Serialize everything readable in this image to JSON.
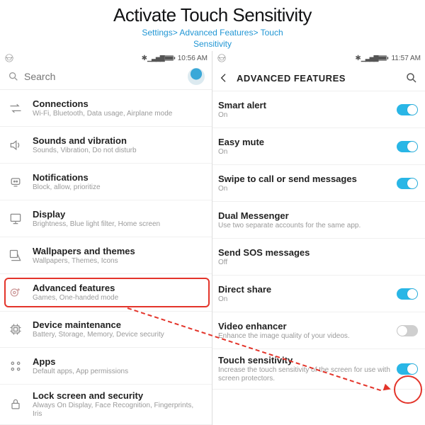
{
  "header": {
    "title": "Activate Touch Sensitivity",
    "pathL1": "Settings> Advanced Features> Touch",
    "pathL2": "Sensitivity"
  },
  "left": {
    "status": {
      "time": "10:56 AM"
    },
    "search": {
      "placeholder": "Search"
    },
    "items": [
      {
        "icon": "arrows-icon",
        "title": "Connections",
        "sub": "Wi-Fi, Bluetooth, Data usage, Airplane mode"
      },
      {
        "icon": "sound-icon",
        "title": "Sounds and vibration",
        "sub": "Sounds, Vibration, Do not disturb"
      },
      {
        "icon": "bell-icon",
        "title": "Notifications",
        "sub": "Block, allow, prioritize"
      },
      {
        "icon": "display-icon",
        "title": "Display",
        "sub": "Brightness, Blue light filter, Home screen"
      },
      {
        "icon": "brush-icon",
        "title": "Wallpapers and themes",
        "sub": "Wallpapers, Themes, Icons"
      },
      {
        "icon": "gear-plus-icon",
        "title": "Advanced features",
        "sub": "Games, One-handed mode"
      },
      {
        "icon": "chip-icon",
        "title": "Device maintenance",
        "sub": "Battery, Storage, Memory, Device security"
      },
      {
        "icon": "apps-icon",
        "title": "Apps",
        "sub": "Default apps, App permissions"
      },
      {
        "icon": "lock-icon",
        "title": "Lock screen and security",
        "sub": "Always On Display, Face Recognition, Fingerprints, Iris"
      }
    ]
  },
  "right": {
    "status": {
      "time": "11:57 AM"
    },
    "title": "ADVANCED FEATURES",
    "items": [
      {
        "title": "Smart alert",
        "sub": "On",
        "toggle": "on"
      },
      {
        "title": "Easy mute",
        "sub": "On",
        "toggle": "on"
      },
      {
        "title": "Swipe to call or send messages",
        "sub": "On",
        "toggle": "on"
      },
      {
        "title": "Dual Messenger",
        "sub": "Use two separate accounts for the same app."
      },
      {
        "title": "Send SOS messages",
        "sub": "Off"
      },
      {
        "title": "Direct share",
        "sub": "On",
        "toggle": "on"
      },
      {
        "title": "Video enhancer",
        "sub": "Enhance the image quality of your videos.",
        "toggle": "off"
      },
      {
        "title": "Touch sensitivity",
        "sub": "Increase the touch sensitivity of the screen for use with screen protectors.",
        "toggle": "on"
      }
    ]
  }
}
